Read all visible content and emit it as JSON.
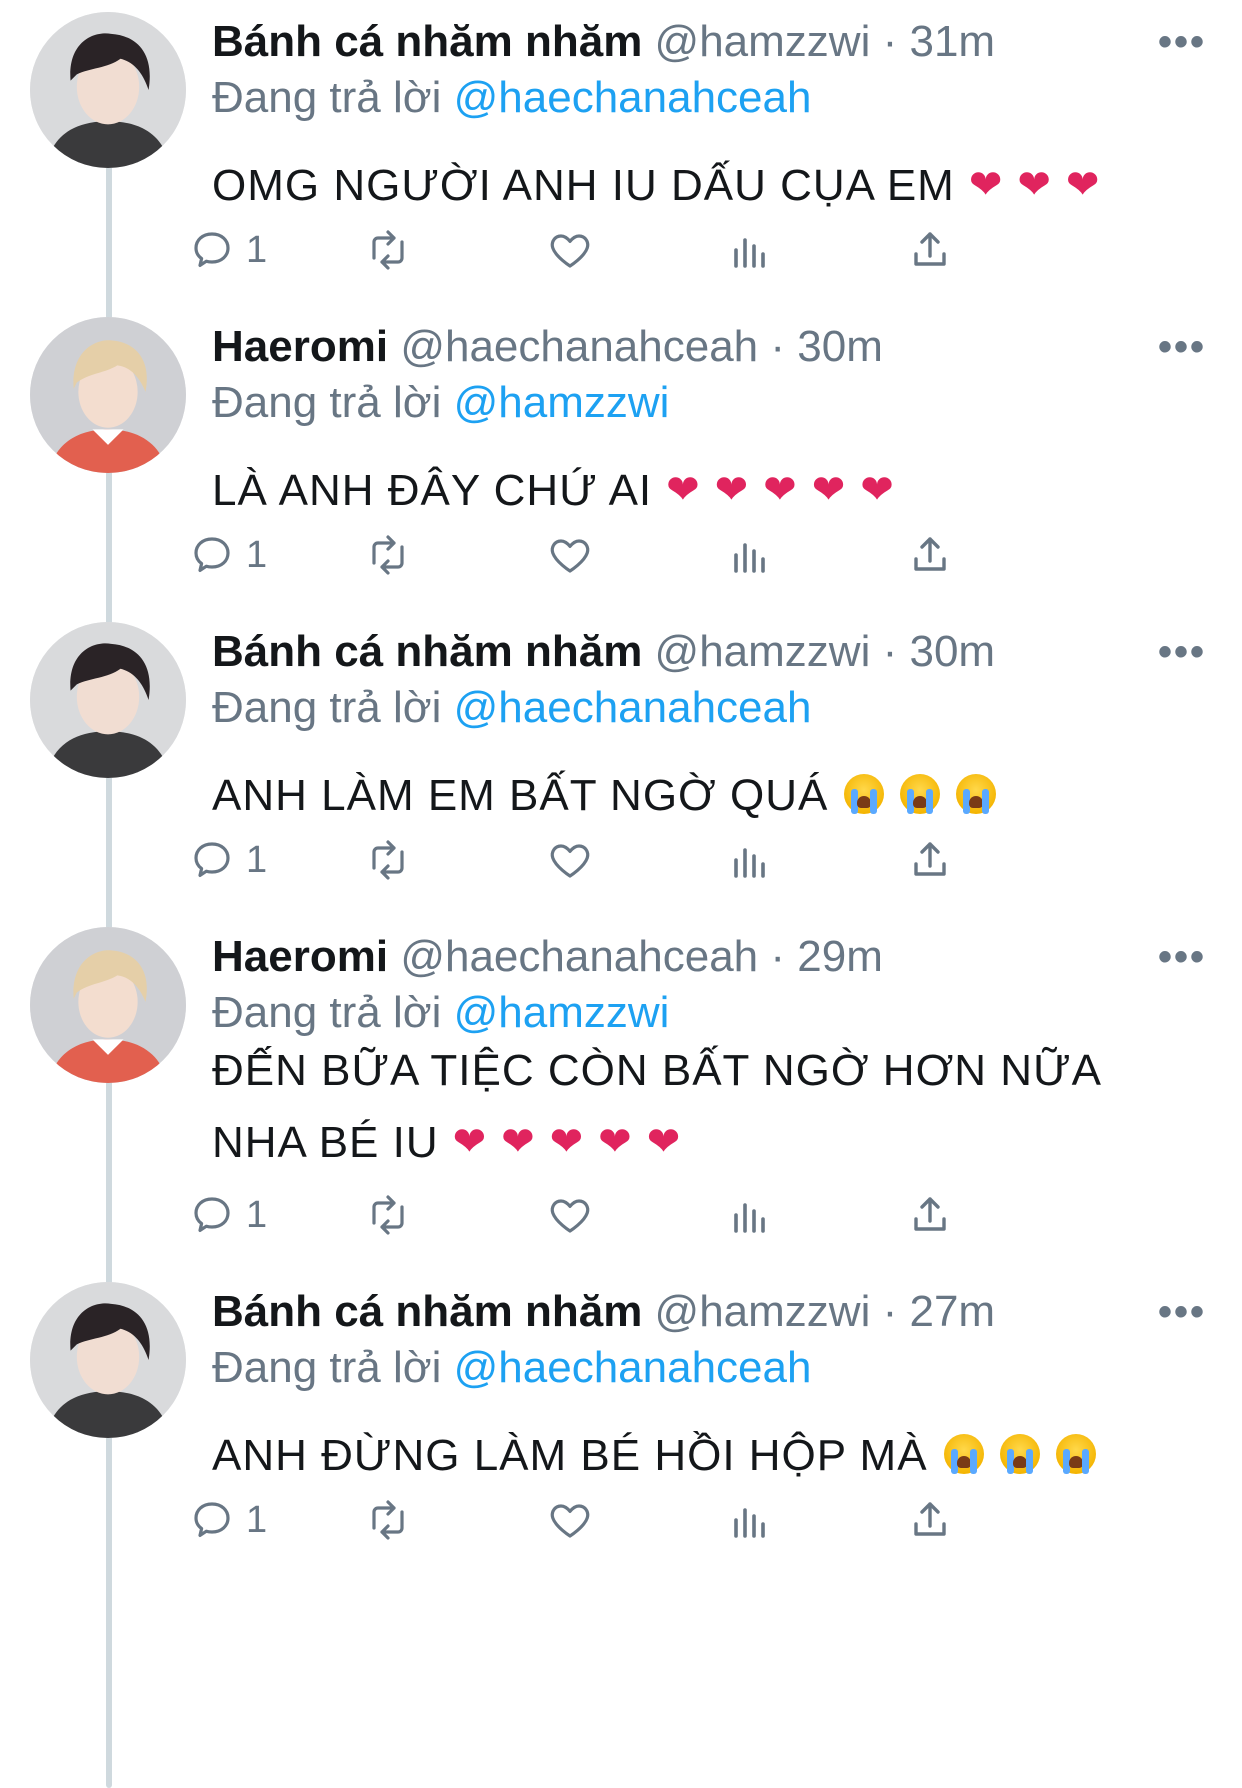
{
  "thread": {
    "tweets": [
      {
        "author": "Bánh cá nhăm nhăm",
        "handle": "@hamzzwi",
        "time": "· 31m",
        "replying_prefix": "Đang trả lời",
        "replying_to": "@haechanahceah",
        "text_lines": [
          "OMG NGƯỜI ANH IU DẤU CỤA EM"
        ],
        "emoji": "red-heart",
        "emoji_count": 3,
        "reply_count": "1",
        "avatar": "hamzzwi-avatar"
      },
      {
        "author": "Haeromi",
        "handle": "@haechanahceah",
        "time": "· 30m",
        "replying_prefix": "Đang trả lời",
        "replying_to": "@hamzzwi",
        "text_lines": [
          "LÀ ANH ĐÂY CHỨ AI"
        ],
        "emoji": "red-heart",
        "emoji_count": 5,
        "reply_count": "1",
        "avatar": "haechanahceah-avatar"
      },
      {
        "author": "Bánh cá nhăm nhăm",
        "handle": "@hamzzwi",
        "time": "· 30m",
        "replying_prefix": "Đang trả lời",
        "replying_to": "@haechanahceah",
        "text_lines": [
          "ANH LÀM EM BẤT NGỜ QUÁ"
        ],
        "emoji": "loudly-crying-face",
        "emoji_count": 3,
        "reply_count": "1",
        "avatar": "hamzzwi-avatar"
      },
      {
        "author": "Haeromi",
        "handle": "@haechanahceah",
        "time": "· 29m",
        "replying_prefix": "Đang trả lời",
        "replying_to": "@hamzzwi",
        "text_lines": [
          "ĐẾN BỮA TIỆC CÒN BẤT NGỜ HƠN NỮA",
          "NHA BÉ IU"
        ],
        "emoji": "red-heart",
        "emoji_count": 5,
        "reply_count": "1",
        "avatar": "haechanahceah-avatar"
      },
      {
        "author": "Bánh cá nhăm nhăm",
        "handle": "@hamzzwi",
        "time": "· 27m",
        "replying_prefix": "Đang trả lời",
        "replying_to": "@haechanahceah",
        "text_lines": [
          "ANH ĐỪNG LÀM BÉ HỒI HỘP MÀ"
        ],
        "emoji": "loudly-crying-face",
        "emoji_count": 3,
        "reply_count": "1",
        "avatar": "hamzzwi-avatar"
      }
    ]
  },
  "icons": {
    "more": "more-dots-icon",
    "reply": "reply-bubble-icon",
    "retweet": "retweet-icon",
    "like": "heart-outline-icon",
    "analytics": "analytics-bars-icon",
    "share": "share-upload-icon"
  },
  "colors": {
    "mention": "#1da1f2",
    "muted": "#687684",
    "heart_emoji": "#e0245e",
    "thread_line": "#cfd9de"
  }
}
